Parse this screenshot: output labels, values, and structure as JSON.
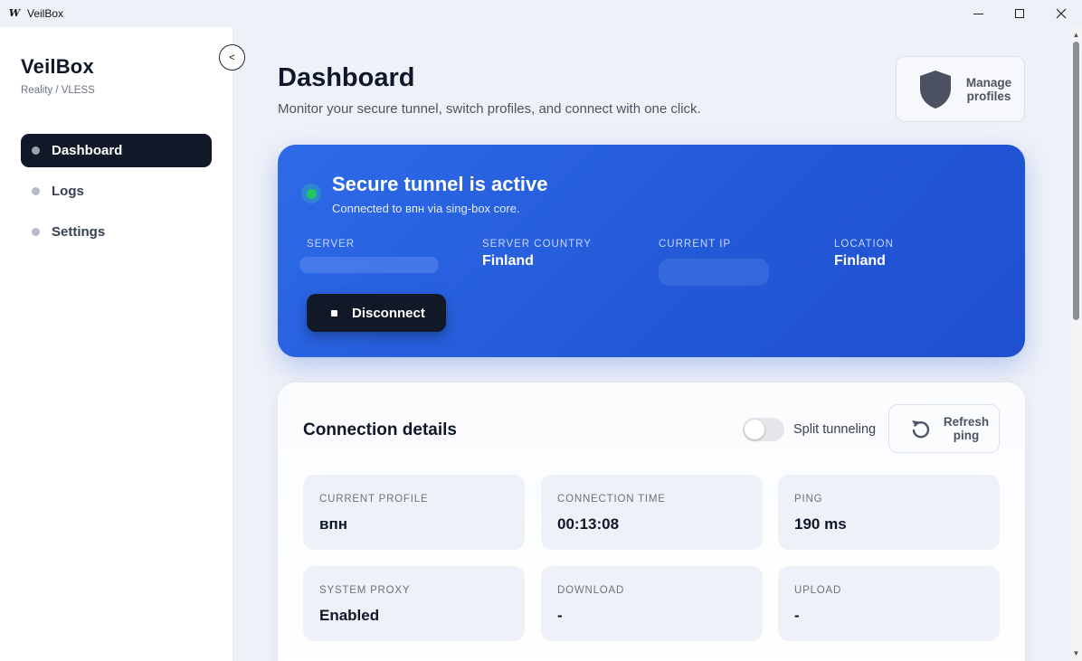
{
  "window": {
    "title": "VeilBox",
    "logo_glyph": "W"
  },
  "sidebar": {
    "brand": "VeilBox",
    "subtitle": "Reality / VLESS",
    "collapse_glyph": "<",
    "items": [
      {
        "label": "Dashboard",
        "active": true
      },
      {
        "label": "Logs",
        "active": false
      },
      {
        "label": "Settings",
        "active": false
      }
    ]
  },
  "header": {
    "title": "Dashboard",
    "subtitle": "Monitor your secure tunnel, switch profiles, and connect with one click.",
    "manage_profiles": "Manage profiles",
    "manage_icon": "shield-icon"
  },
  "hero": {
    "status_title": "Secure tunnel is active",
    "status_sub": "Connected to впн via sing-box core.",
    "stats": [
      {
        "label": "SERVER",
        "value": ""
      },
      {
        "label": "SERVER COUNTRY",
        "value": "Finland"
      },
      {
        "label": "CURRENT IP",
        "value": ""
      },
      {
        "label": "LOCATION",
        "value": "Finland"
      }
    ],
    "disconnect": "Disconnect"
  },
  "details": {
    "title": "Connection details",
    "split_tunneling": {
      "label": "Split tunneling",
      "enabled": false
    },
    "refresh_ping": "Refresh ping",
    "tiles": [
      {
        "label": "CURRENT PROFILE",
        "value": "впн"
      },
      {
        "label": "CONNECTION TIME",
        "value": "00:13:08"
      },
      {
        "label": "PING",
        "value": "190 ms"
      },
      {
        "label": "SYSTEM PROXY",
        "value": "Enabled"
      },
      {
        "label": "DOWNLOAD",
        "value": "-"
      },
      {
        "label": "UPLOAD",
        "value": "-"
      }
    ]
  },
  "colors": {
    "accent": "#2563eb",
    "dark": "#111827",
    "status_green": "#22c55e"
  }
}
